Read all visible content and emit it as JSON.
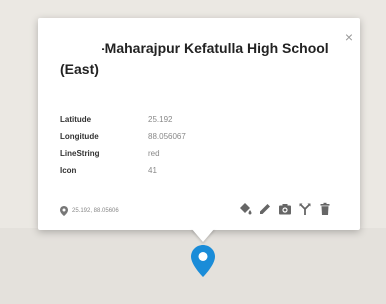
{
  "infowindow": {
    "title": "-Maharajpur Kefatulla High School (East)",
    "close_label": "×",
    "properties": [
      {
        "key": "Latitude",
        "value": "25.192"
      },
      {
        "key": "Longitude",
        "value": "88.056067"
      },
      {
        "key": "LineString",
        "value": "red"
      },
      {
        "key": "Icon",
        "value": "41"
      }
    ],
    "coords_text": "25.192, 88.05606",
    "tools": [
      "paint-bucket-icon",
      "pencil-icon",
      "camera-icon",
      "route-icon",
      "trash-icon"
    ]
  },
  "marker": {
    "icon": "map-pin-icon",
    "color": "#1a8cd8"
  }
}
